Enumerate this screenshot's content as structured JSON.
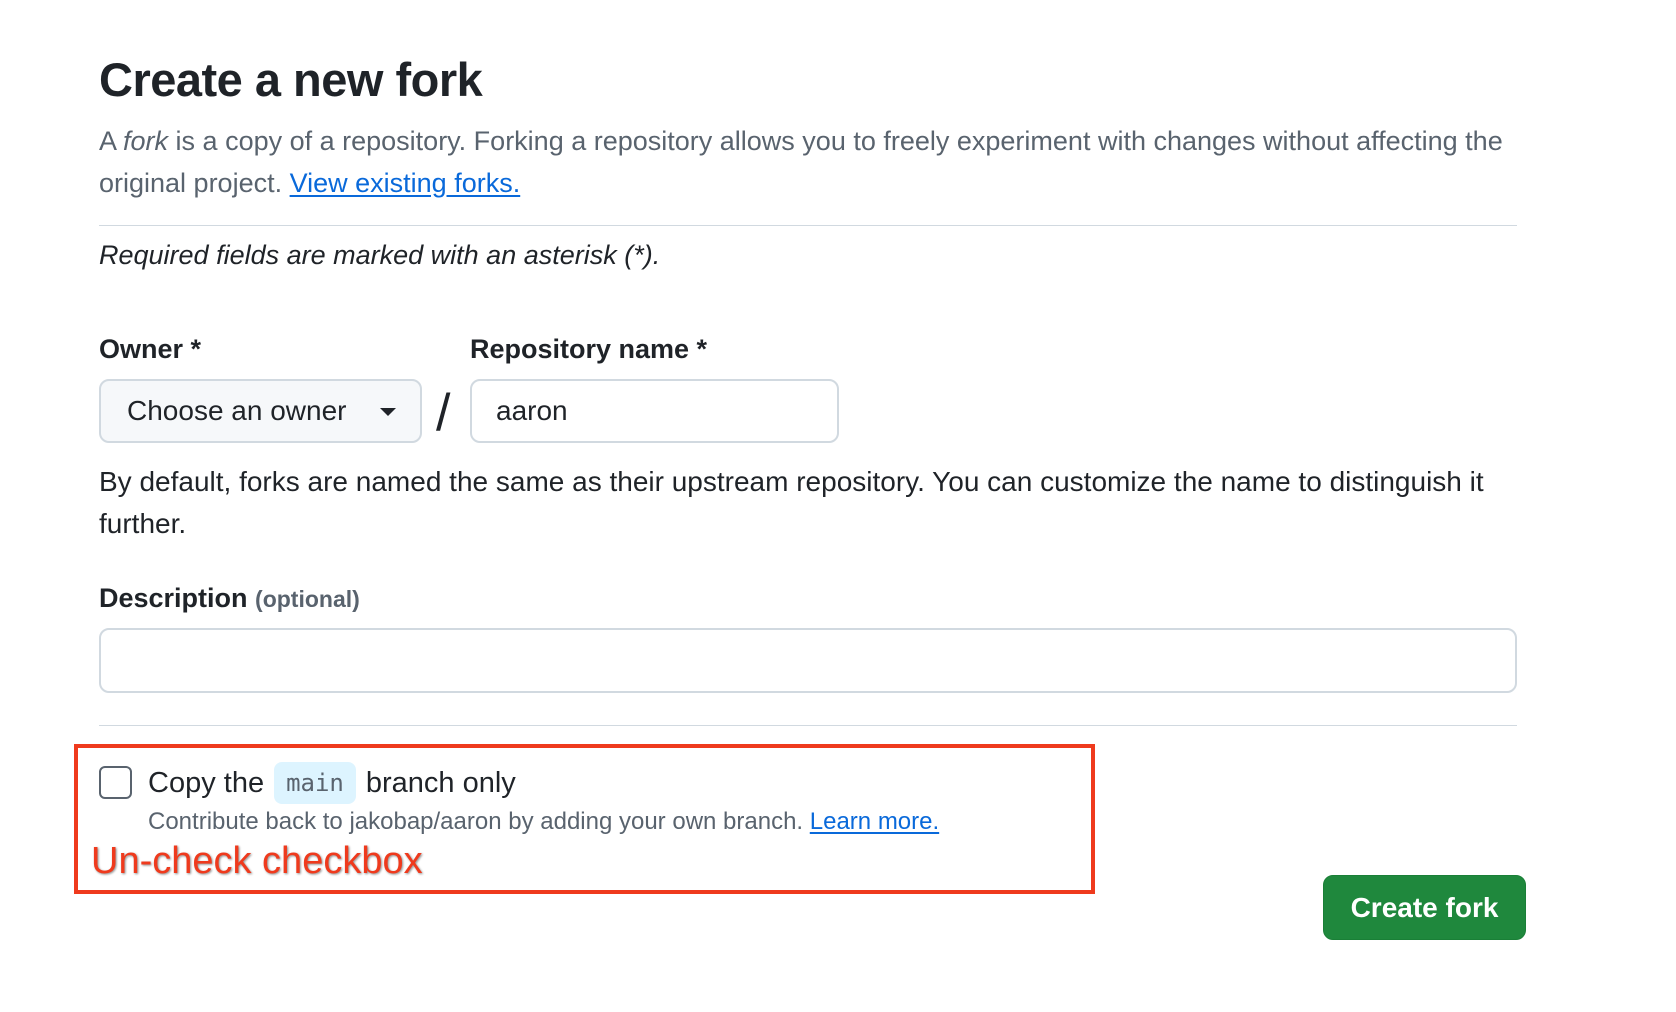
{
  "page": {
    "title": "Create a new fork",
    "intro": {
      "prefix": "A ",
      "fork_word": "fork",
      "middle": " is a copy of a repository. Forking a repository allows you to freely experiment with changes without affecting the original project. ",
      "link": "View existing forks."
    },
    "required_note": "Required fields are marked with an asterisk (*)."
  },
  "form": {
    "owner": {
      "label": "Owner *",
      "selected": "Choose an owner"
    },
    "separator": "/",
    "repo_name": {
      "label": "Repository name *",
      "value": "aaron"
    },
    "name_help": "By default, forks are named the same as their upstream repository. You can customize the name to distinguish it further.",
    "description": {
      "label": "Description",
      "optional": "(optional)",
      "value": ""
    },
    "copy_branch": {
      "checked": false,
      "label_prefix": "Copy the",
      "branch": "main",
      "label_suffix": "branch only",
      "help": "Contribute back to jakobap/aaron by adding your own branch.",
      "help_link": "Learn more."
    },
    "submit_label": "Create fork"
  },
  "annotation": {
    "text": "Un-check checkbox",
    "color": "#ef3a1d"
  },
  "colors": {
    "primary_button": "#1f883d",
    "link": "#0969da",
    "muted_text": "#59636e",
    "border": "#d1d9e0"
  }
}
